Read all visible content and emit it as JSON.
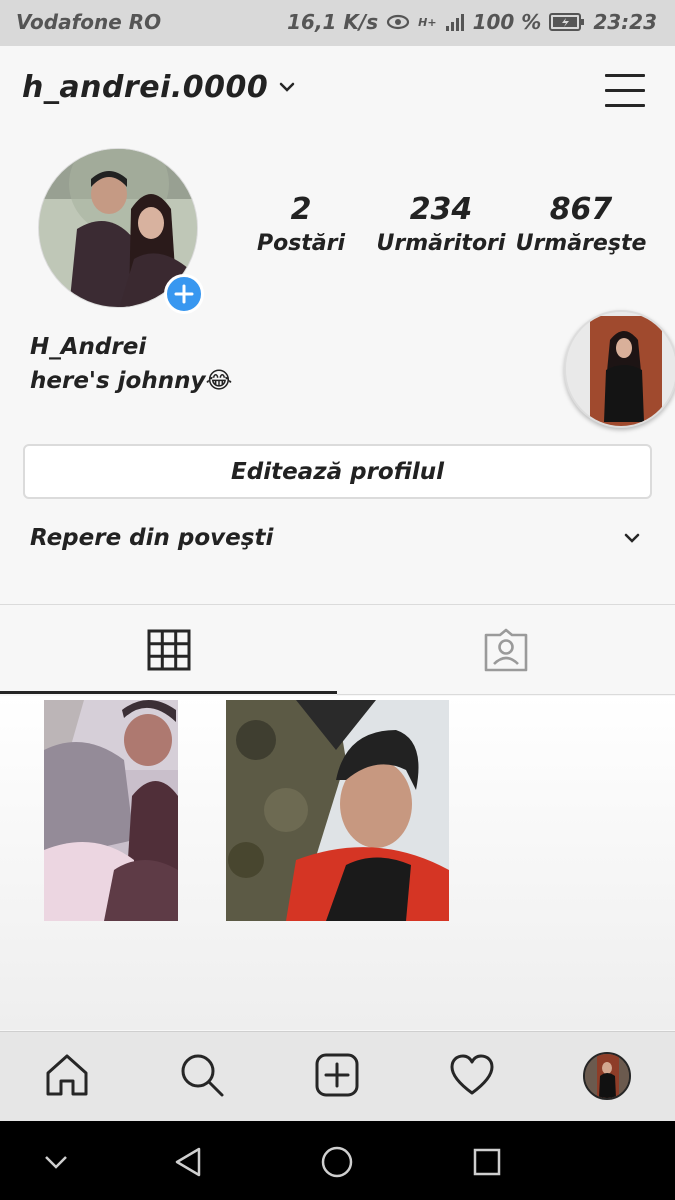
{
  "status_bar": {
    "carrier": "Vodafone RO",
    "speed": "16,1 K/s",
    "network": "H+",
    "battery": "100 %",
    "time": "23:23"
  },
  "profile": {
    "username": "h_andrei.0000",
    "full_name": "H_Andrei",
    "bio": "here's johnny😂",
    "edit_label": "Editează profilul",
    "highlights_label": "Repere din poveşti"
  },
  "stats": [
    {
      "value": "2",
      "label": "Postări"
    },
    {
      "value": "234",
      "label": "Urmăritori"
    },
    {
      "value": "867",
      "label": "Urmăreşte"
    }
  ],
  "tabs": [
    {
      "icon": "grid-icon"
    },
    {
      "icon": "tagged-photos-icon"
    }
  ],
  "posts": [
    {
      "description_icon": "photo-couple"
    },
    {
      "description_icon": "photo-selfie"
    }
  ],
  "bottom_nav": [
    {
      "icon": "home-icon"
    },
    {
      "icon": "search-icon"
    },
    {
      "icon": "add-post-icon"
    },
    {
      "icon": "heart-icon"
    },
    {
      "icon": "profile-avatar"
    }
  ],
  "system_nav": [
    {
      "icon": "chevron-down-icon"
    },
    {
      "icon": "back-triangle-icon"
    },
    {
      "icon": "home-circle-icon"
    },
    {
      "icon": "recents-square-icon"
    }
  ],
  "colors": {
    "accent_blue": "#3897f0",
    "text": "#262626",
    "background": "#f7f7f7"
  }
}
